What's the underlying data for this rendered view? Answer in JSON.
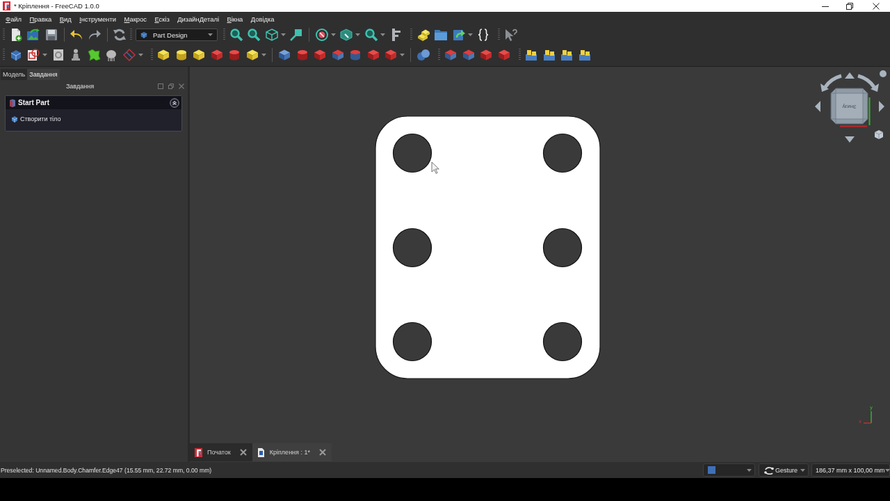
{
  "window": {
    "title": "* Кріплення - FreeCAD 1.0.0"
  },
  "menu": [
    "Файл",
    "Правка",
    "Вид",
    "Інструменти",
    "Макрос",
    "Ескіз",
    "ДизайнДеталі",
    "Вікна",
    "Довідка"
  ],
  "toolbar": {
    "workbench": "Part Design"
  },
  "side_panel": {
    "tabs": [
      {
        "label": "Модель",
        "selected": false
      },
      {
        "label": "Завдання",
        "selected": true
      }
    ],
    "title": "Завдання",
    "task_box": {
      "title": "Start Part",
      "expanded": true,
      "actions": [
        "Створити тіло"
      ]
    }
  },
  "view": {
    "nav_cube": {
      "face": "Знизу"
    },
    "axis_labels": {
      "x": "x",
      "y": "y"
    }
  },
  "document_tabs": [
    {
      "label": "Початок",
      "kind": "start",
      "selected": false
    },
    {
      "label": "Кріплення : 1*",
      "kind": "document",
      "selected": true
    }
  ],
  "status_bar": {
    "message": "Preselected: Unnamed.Body.Chamfer.Edge47 (15.55 mm, 22.72 mm, 0.00 mm)",
    "navigation": "Gesture",
    "dimensions": "186,37 mm x 100,00 mm"
  }
}
